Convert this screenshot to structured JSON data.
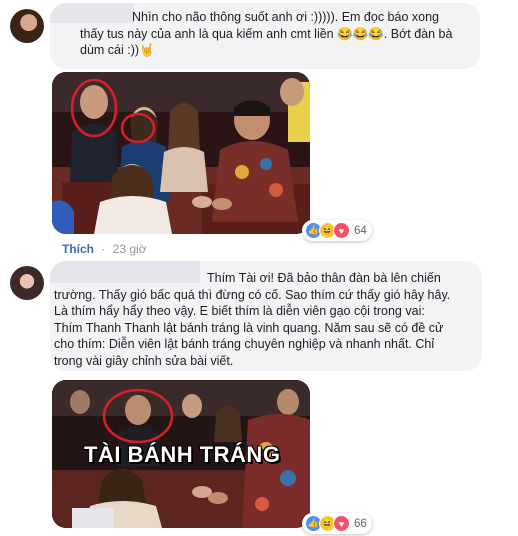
{
  "comments": [
    {
      "text": "Nhìn cho não thông suốt anh ơi :))))). Em đọc báo xong\nthấy tus này của anh là qua kiếm anh cmt liền 😂😂😂. Bớt đàn bà\ndùm cái :))🤘",
      "reactions": {
        "icons": [
          "like-reaction-icon",
          "haha-reaction-icon",
          "love-reaction-icon"
        ],
        "count": "64"
      },
      "like_label": "Thích",
      "separator": "·",
      "time": "23 giờ"
    },
    {
      "text": "Thím Tài ơi! Đã bảo thân đàn bà lên chiến\ntrường. Thấy gió bấc quá thì đừng có cố. Sao thím cứ thấy gió hây hây.\nLà thím hẩy hẩy theo vậy. E biết thím là diễn viên gạo cội trong vai:\nThím Thanh Thanh lật bánh tráng là vinh quang. Năm sau sẽ có đề cử\ncho thím: Diễn viên lật bánh tráng chuyên nghiệp và nhanh nhất. Chỉ\ntrong vài giây chỉnh sửa bài viết.",
      "image_caption": "TÀI BÁNH TRÁNG",
      "reactions": {
        "icons": [
          "like-reaction-icon",
          "haha-reaction-icon",
          "love-reaction-icon"
        ],
        "count": "66"
      }
    }
  ],
  "colors": {
    "bubble": "#f2f3f5",
    "link": "#4267b2",
    "meta": "#90949c",
    "circle": "#d8202a"
  }
}
